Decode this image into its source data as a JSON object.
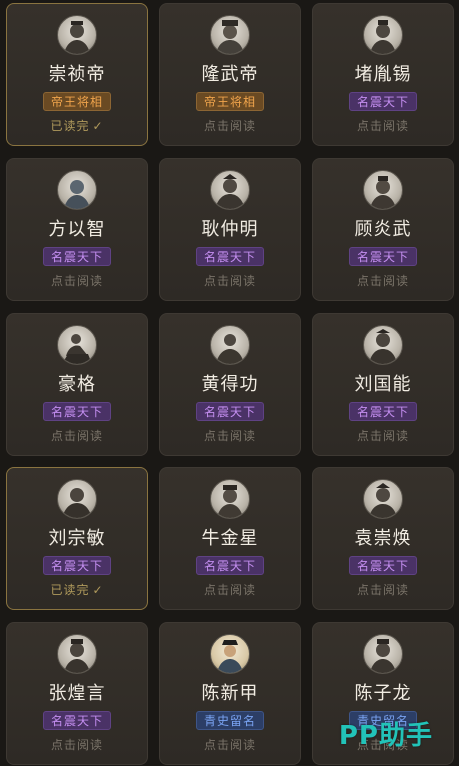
{
  "cards": [
    {
      "name": "崇祯帝",
      "badge": "帝王将相",
      "status": "已读完"
    },
    {
      "name": "隆武帝",
      "badge": "帝王将相",
      "status": "点击阅读"
    },
    {
      "name": "堵胤锡",
      "badge": "名震天下",
      "status": "点击阅读"
    },
    {
      "name": "方以智",
      "badge": "名震天下",
      "status": "点击阅读"
    },
    {
      "name": "耿仲明",
      "badge": "名震天下",
      "status": "点击阅读"
    },
    {
      "name": "顾炎武",
      "badge": "名震天下",
      "status": "点击阅读"
    },
    {
      "name": "豪格",
      "badge": "名震天下",
      "status": "点击阅读"
    },
    {
      "name": "黄得功",
      "badge": "名震天下",
      "status": "点击阅读"
    },
    {
      "name": "刘国能",
      "badge": "名震天下",
      "status": "点击阅读"
    },
    {
      "name": "刘宗敏",
      "badge": "名震天下",
      "status": "已读完"
    },
    {
      "name": "牛金星",
      "badge": "名震天下",
      "status": "点击阅读"
    },
    {
      "name": "袁崇焕",
      "badge": "名震天下",
      "status": "点击阅读"
    },
    {
      "name": "张煌言",
      "badge": "名震天下",
      "status": "点击阅读"
    },
    {
      "name": "陈新甲",
      "badge": "青史留名",
      "status": "点击阅读"
    },
    {
      "name": "陈子龙",
      "badge": "青史留名",
      "status": "点击阅读"
    }
  ],
  "check_mark": "✓",
  "watermark": "PP助手",
  "colors": {
    "background": "#1a1815",
    "badge_royal": "#f0a44c",
    "badge_famous": "#c48ef0",
    "badge_history": "#7aa3f2",
    "read_border": "#8a7440",
    "watermark": "#22c3b8"
  }
}
